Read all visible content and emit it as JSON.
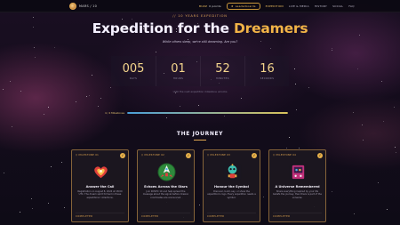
{
  "nav": {
    "brand_name": "MARS / 10",
    "links": [
      {
        "label": "BUZZ",
        "sub": "0 points",
        "active": true
      },
      {
        "label": "Leaderboards",
        "button": true
      },
      {
        "label": "EXPEDITION",
        "active": true
      },
      {
        "label": "LIVE & MEDIA"
      },
      {
        "label": "HISTORY"
      },
      {
        "label": "SOCIAL"
      },
      {
        "label": "FAQ"
      }
    ]
  },
  "hero": {
    "eyebrow": "// 10 YEARS EXPEDITION",
    "title_main": "Expedition for the ",
    "title_accent": "Dreamers",
    "subtitle": "While others sleep, we're still dreaming. Are you?"
  },
  "countdown": {
    "units": [
      {
        "value": "005",
        "label": "DAYS"
      },
      {
        "value": "01",
        "label": "HOURS"
      },
      {
        "value": "52",
        "label": "MINUTES"
      },
      {
        "value": "16",
        "label": "SECONDS"
      }
    ],
    "caption": "Until the next expedition milestone unlocks"
  },
  "progress": {
    "label": "4 / 4 Milestones",
    "fraction": 1.0
  },
  "journey": {
    "title": "THE JOURNEY",
    "cards": [
      {
        "tag": "// MILESTONE 01",
        "icon": "heart-icon",
        "title": "Answer the Call",
        "body": "Registration on August 8, 2024 at 18:00 UTC. The dream spirit formed in these expeditions' collections.",
        "status": "COMPLETED"
      },
      {
        "tag": "// MILESTONE 02",
        "icon": "planet-ship-icon",
        "title": "Echoes Across the Stars",
        "body": "Join ROVEX 10 and help spread the message about the signal before mission coordinates are announced.",
        "status": "COMPLETED"
      },
      {
        "tag": "// MILESTONE 03",
        "icon": "robot-icon",
        "title": "Honour the Symbol",
        "body": "Discover, build, say, or show the expedition's logo. Every expedition needs a symbol.",
        "status": "COMPLETED"
      },
      {
        "tag": "// MILESTONE 04",
        "icon": "arcade-icon",
        "title": "A Universe Remembered",
        "body": "Share everything inspired by your life beliefs the journey, then there is part of the universe.",
        "status": "COMPLETED"
      }
    ]
  },
  "colors": {
    "accent": "#f2b447",
    "background": "#0e0b16",
    "card_border": "#e0a650"
  }
}
